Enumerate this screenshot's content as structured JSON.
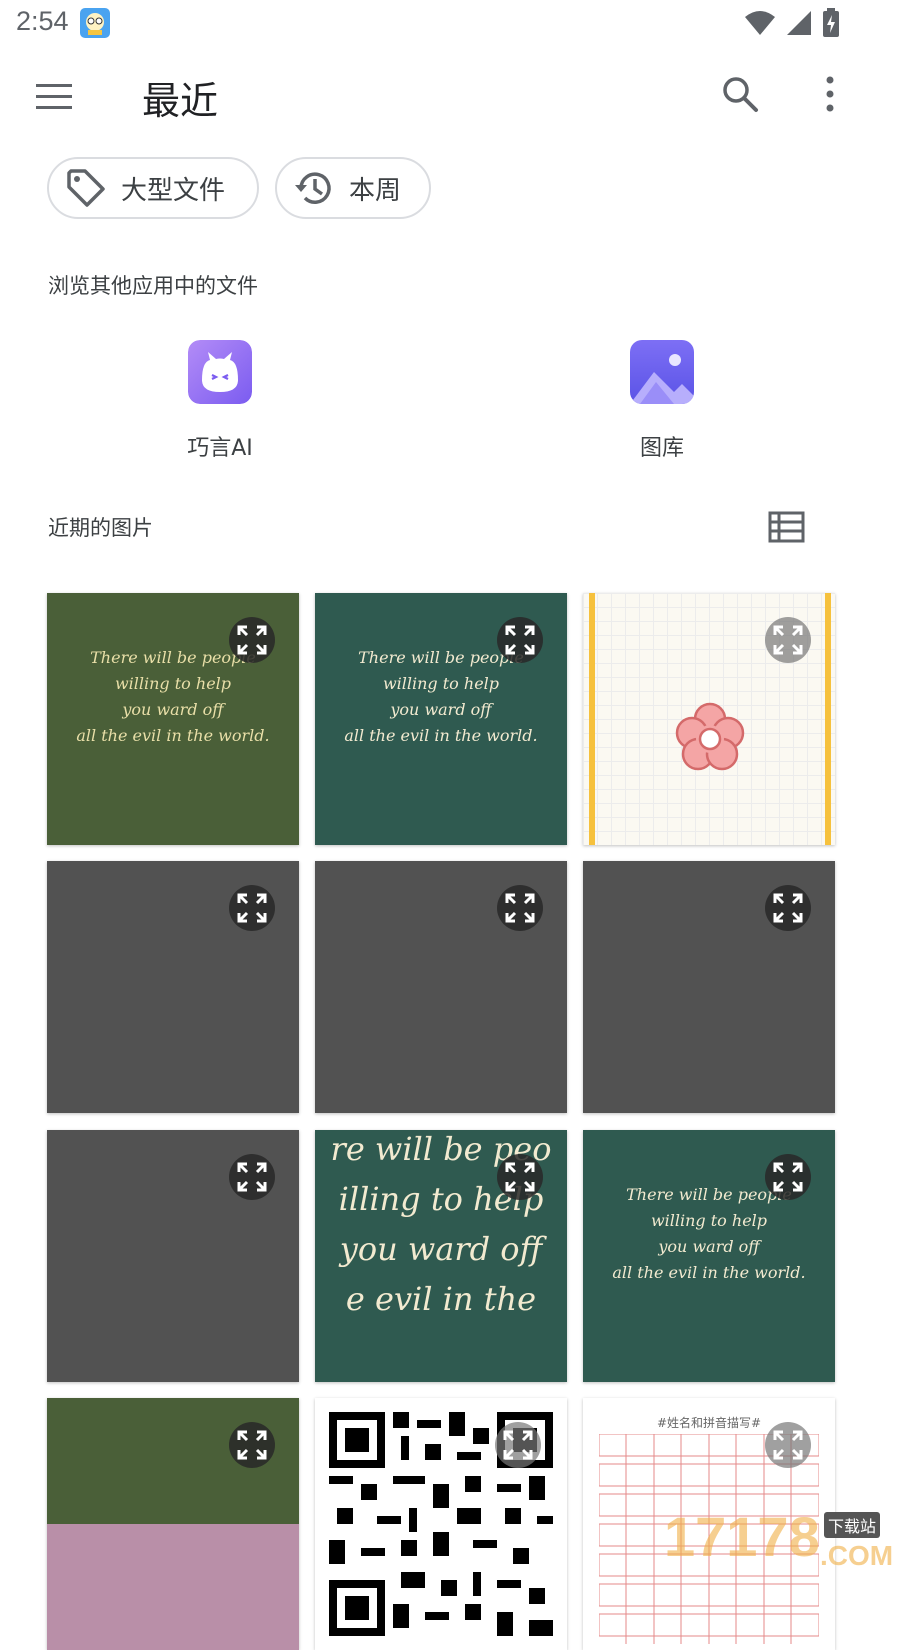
{
  "status_bar": {
    "time": "2:54"
  },
  "app_bar": {
    "title": "最近"
  },
  "chips": [
    {
      "label": "大型文件",
      "icon": "tag-icon"
    },
    {
      "label": "本周",
      "icon": "history-icon"
    }
  ],
  "browse_section": {
    "label": "浏览其他应用中的文件",
    "apps": [
      {
        "name": "巧言AI",
        "icon": "cat-face-icon",
        "color": "#8b6cf5"
      },
      {
        "name": "图库",
        "icon": "gallery-icon",
        "color": "#6a62f0"
      }
    ]
  },
  "recent_section": {
    "label": "近期的图片"
  },
  "quote": {
    "lines": [
      "There will be people",
      "willing to help",
      "you ward off",
      "all the evil in the world."
    ]
  },
  "quote_zoomed": {
    "lines": [
      "re will be peo",
      "illing to help",
      "you ward off",
      "e evil in the"
    ]
  },
  "qr_caption": "#姓名和拼音描写#",
  "watermark": {
    "big": "17178",
    "com": ".COM",
    "small": "下载站"
  },
  "colors": {
    "dark_green": "#4a5f38",
    "teal": "#2f5a50",
    "gray": "#525252",
    "accent_purple": "#7b5cf0"
  }
}
